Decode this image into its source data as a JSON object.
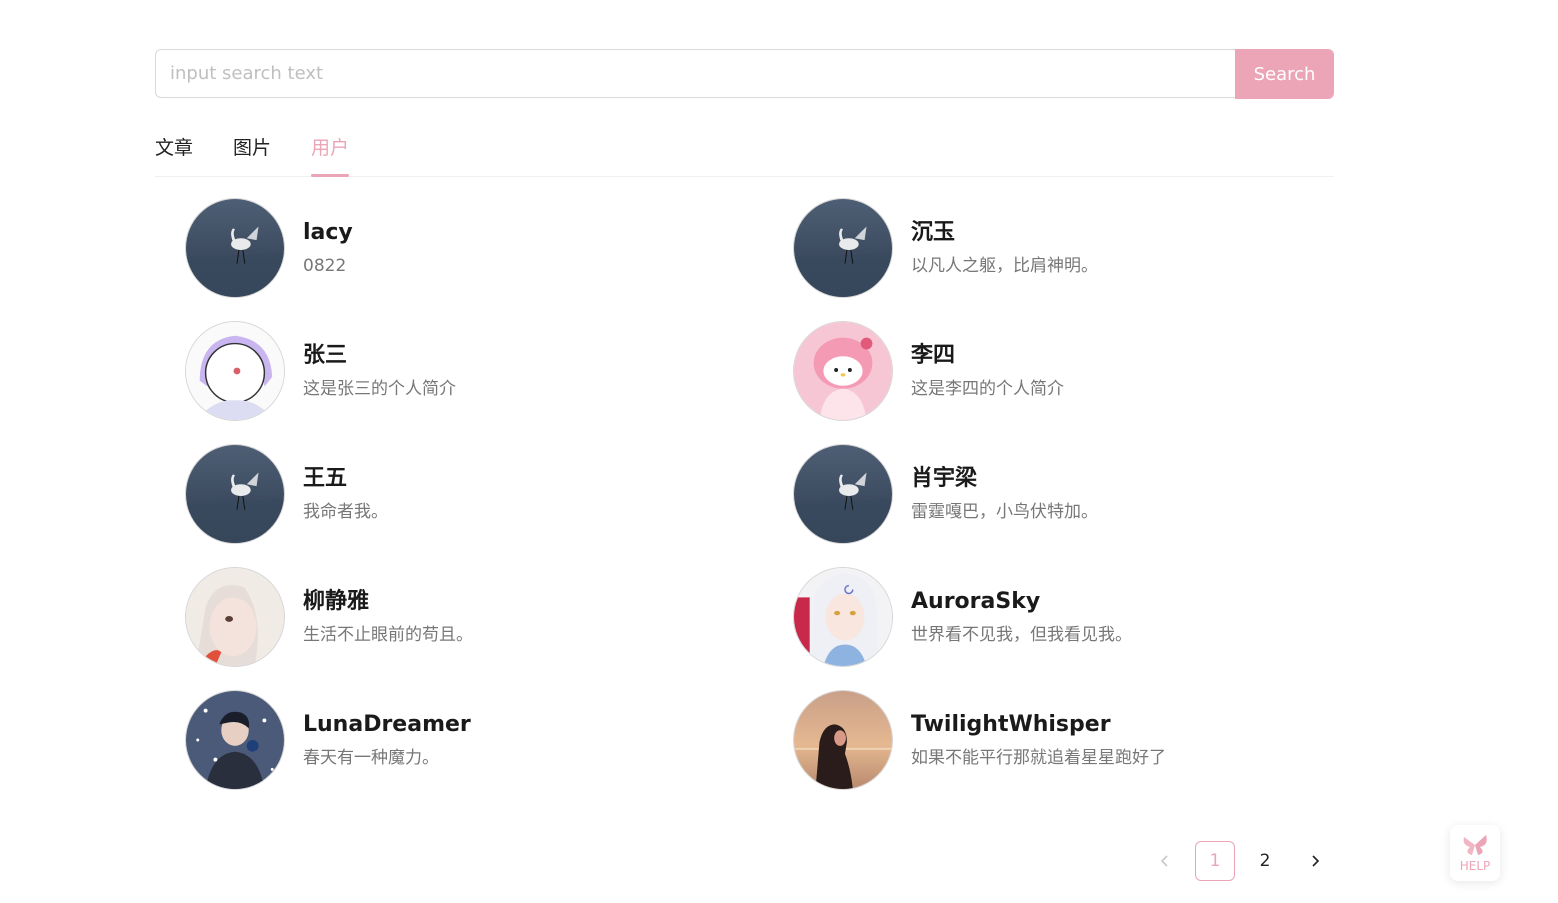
{
  "search": {
    "placeholder": "input search text",
    "value": "",
    "button_label": "Search"
  },
  "tabs": [
    {
      "label": "文章",
      "active": false
    },
    {
      "label": "图片",
      "active": false
    },
    {
      "label": "用户",
      "active": true
    }
  ],
  "users": [
    {
      "name": "lacy",
      "bio": "0822",
      "avatar": "heron-lake"
    },
    {
      "name": "沉玉",
      "bio": "以凡人之躯，比肩神明。",
      "avatar": "heron-lake"
    },
    {
      "name": "张三",
      "bio": "这是张三的个人简介",
      "avatar": "cartoon-rainbow-character"
    },
    {
      "name": "李四",
      "bio": "这是李四的个人简介",
      "avatar": "pink-bunny-character"
    },
    {
      "name": "王五",
      "bio": "我命者我。",
      "avatar": "heron-lake"
    },
    {
      "name": "肖宇梁",
      "bio": "雷霆嘎巴，小鸟伏特加。",
      "avatar": "heron-lake"
    },
    {
      "name": "柳静雅",
      "bio": "生活不止眼前的苟且。",
      "avatar": "anime-girl-pale"
    },
    {
      "name": "AuroraSky",
      "bio": "世界看不见我，但我看见我。",
      "avatar": "anime-girl-white-hair"
    },
    {
      "name": "LunaDreamer",
      "bio": "春天有一种魔力。",
      "avatar": "man-in-snow"
    },
    {
      "name": "TwilightWhisper",
      "bio": "如果不能平行那就追着星星跑好了",
      "avatar": "girl-at-sunset"
    }
  ],
  "pagination": {
    "prev_icon": "chevron-left-icon",
    "pages": [
      "1",
      "2"
    ],
    "current": "1",
    "next_icon": "chevron-right-icon"
  },
  "help": {
    "label": "HELP",
    "icon": "butterfly-icon"
  },
  "colors": {
    "accent": "#eba5b7"
  }
}
